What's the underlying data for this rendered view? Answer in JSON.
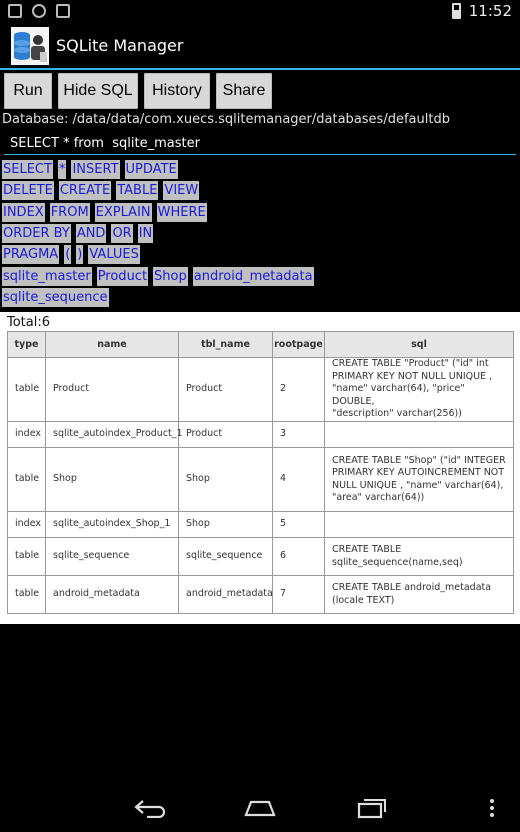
{
  "status": {
    "time": "11:52"
  },
  "app": {
    "title": "SQLite Manager"
  },
  "toolbar": {
    "run": "Run",
    "hide_sql": "Hide SQL",
    "history": "History",
    "share": "Share"
  },
  "db_path": "Database: /data/data/com.xuecs.sqlitemanager/databases/defaultdb",
  "sql": {
    "value": "SELECT * from  sqlite_master"
  },
  "keywords": [
    [
      "SELECT",
      "*",
      "INSERT",
      "UPDATE"
    ],
    [
      "DELETE",
      "CREATE",
      "TABLE",
      "VIEW"
    ],
    [
      "INDEX",
      "FROM",
      "EXPLAIN",
      "WHERE"
    ],
    [
      "ORDER BY",
      "AND",
      "OR",
      "IN"
    ],
    [
      "PRAGMA",
      "(",
      ")",
      "VALUES"
    ],
    [
      "sqlite_master",
      "Product",
      "Shop",
      "android_metadata"
    ],
    [
      "sqlite_sequence"
    ]
  ],
  "results": {
    "total": "Total:6",
    "columns": [
      "type",
      "name",
      "tbl_name",
      "rootpage",
      "sql"
    ],
    "rows": [
      [
        "table",
        "Product",
        "Product",
        "2",
        "CREATE TABLE \"Product\" (\"id\" int\nPRIMARY KEY NOT NULL UNIQUE ,\n\"name\" varchar(64), \"price\" DOUBLE,\n\"description\" varchar(256))"
      ],
      [
        "index",
        "sqlite_autoindex_Product_1",
        "Product",
        "3",
        ""
      ],
      [
        "table",
        "Shop",
        "Shop",
        "4",
        "CREATE TABLE \"Shop\" (\"id\" INTEGER\nPRIMARY KEY AUTOINCREMENT NOT\nNULL UNIQUE , \"name\" varchar(64),\n\"area\" varchar(64))"
      ],
      [
        "index",
        "sqlite_autoindex_Shop_1",
        "Shop",
        "5",
        ""
      ],
      [
        "table",
        "sqlite_sequence",
        "sqlite_sequence",
        "6",
        "CREATE TABLE\nsqlite_sequence(name,seq)"
      ],
      [
        "table",
        "android_metadata",
        "android_metadata",
        "7",
        "CREATE TABLE android_metadata\n(locale TEXT)"
      ]
    ]
  },
  "colors": {
    "accent": "#33b5e5",
    "keyword_text": "#1a1adc",
    "keyword_bg": "#c0c0c0",
    "button_bg": "#d8d8d8"
  },
  "icons": [
    "image-icon",
    "usb-icon",
    "sd-card-icon",
    "battery-icon",
    "app-icon",
    "back-icon",
    "home-icon",
    "recents-icon",
    "overflow-menu-icon"
  ]
}
